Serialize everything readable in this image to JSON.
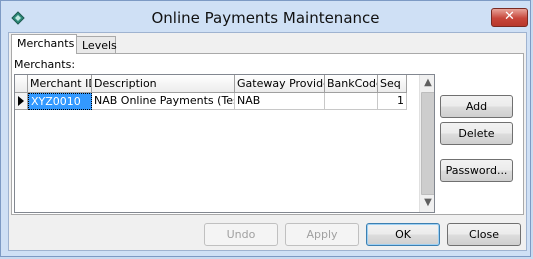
{
  "window": {
    "title": "Online Payments Maintenance",
    "close_glyph": "✕",
    "icon": "app-diamond-icon"
  },
  "tabs": [
    {
      "label": "Merchants"
    },
    {
      "label": "Levels"
    }
  ],
  "merchants": {
    "group_label": "Merchants:",
    "columns": [
      "Merchant ID",
      "Description",
      "Gateway Provider",
      "BankCode",
      "Seq"
    ],
    "rows": [
      {
        "merchant_id": "XYZ0010",
        "description": "NAB Online Payments (Test)",
        "gateway_provider": "NAB",
        "bank_code": "",
        "seq": "1"
      }
    ]
  },
  "side_buttons": {
    "add": "Add",
    "delete": "Delete",
    "password": "Password..."
  },
  "bottom_buttons": {
    "undo": "Undo",
    "apply": "Apply",
    "ok": "OK",
    "close": "Close"
  },
  "scrollbar": {
    "up_glyph": "▲",
    "down_glyph": "▼"
  }
}
